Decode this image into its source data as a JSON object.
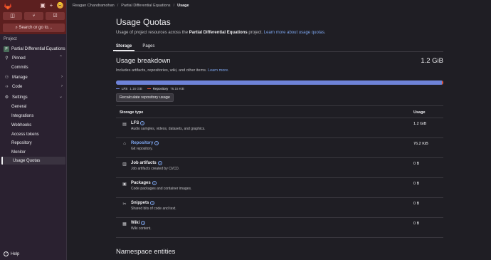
{
  "sidebar": {
    "avatar_initial": "😄",
    "search_label": "Search or go to…",
    "section_label": "Project",
    "project_badge": "P",
    "project_name": "Partial Differential Equations",
    "items": [
      {
        "label": "Pinned",
        "icon": "pin-icon"
      },
      {
        "label": "Commits"
      },
      {
        "label": "Manage",
        "icon": "users-icon"
      },
      {
        "label": "Code",
        "icon": "code-icon"
      },
      {
        "label": "Settings",
        "icon": "settings-icon"
      },
      {
        "label": "General"
      },
      {
        "label": "Integrations"
      },
      {
        "label": "Webhooks"
      },
      {
        "label": "Access tokens"
      },
      {
        "label": "Repository"
      },
      {
        "label": "Monitor"
      },
      {
        "label": "Usage Quotas"
      }
    ],
    "help_label": "Help"
  },
  "breadcrumb": {
    "user": "Reagan Chandramohan",
    "project": "Partial Differential Equations",
    "current": "Usage"
  },
  "page": {
    "title": "Usage Quotas",
    "subtitle_prefix": "Usage of project resources across the ",
    "subtitle_project": "Partial Differential Equations",
    "subtitle_suffix": " project. ",
    "subtitle_link": "Learn more about usage quotas",
    "tabs": [
      "Storage",
      "Pages"
    ]
  },
  "breakdown": {
    "title": "Usage breakdown",
    "total": "1.2 GiB",
    "desc": "Includes artifacts, repositories, wiki, and other items.",
    "desc_link": "Learn more.",
    "lfs_fraction": 0.94,
    "legend": [
      {
        "name": "LFS",
        "value": "1.16 GiB",
        "color": "#6e83d8"
      },
      {
        "name": "Repository",
        "value": "76.15 KiB",
        "color": "#e0523b"
      }
    ],
    "recalc_label": "Recalculate repository usage"
  },
  "table": {
    "col_type": "Storage type",
    "col_usage": "Usage",
    "rows": [
      {
        "name": "LFS",
        "desc": "Audio samples, videos, datasets, and graphics.",
        "value": "1.2 GiB",
        "icon": "doc-icon"
      },
      {
        "name": "Repository",
        "desc": "Git repository.",
        "value": "76.2 KiB",
        "icon": "repo-icon"
      },
      {
        "name": "Job artifacts",
        "desc": "Job artifacts created by CI/CD.",
        "value": "0 B",
        "icon": "artifact-icon"
      },
      {
        "name": "Packages",
        "desc": "Code packages and container images.",
        "value": "0 B",
        "icon": "package-icon"
      },
      {
        "name": "Snippets",
        "desc": "Shared bits of code and text.",
        "value": "0 B",
        "icon": "snippet-icon"
      },
      {
        "name": "Wiki",
        "desc": "Wiki content.",
        "value": "0 B",
        "icon": "wiki-icon"
      }
    ]
  },
  "namespace_title": "Namespace entities"
}
